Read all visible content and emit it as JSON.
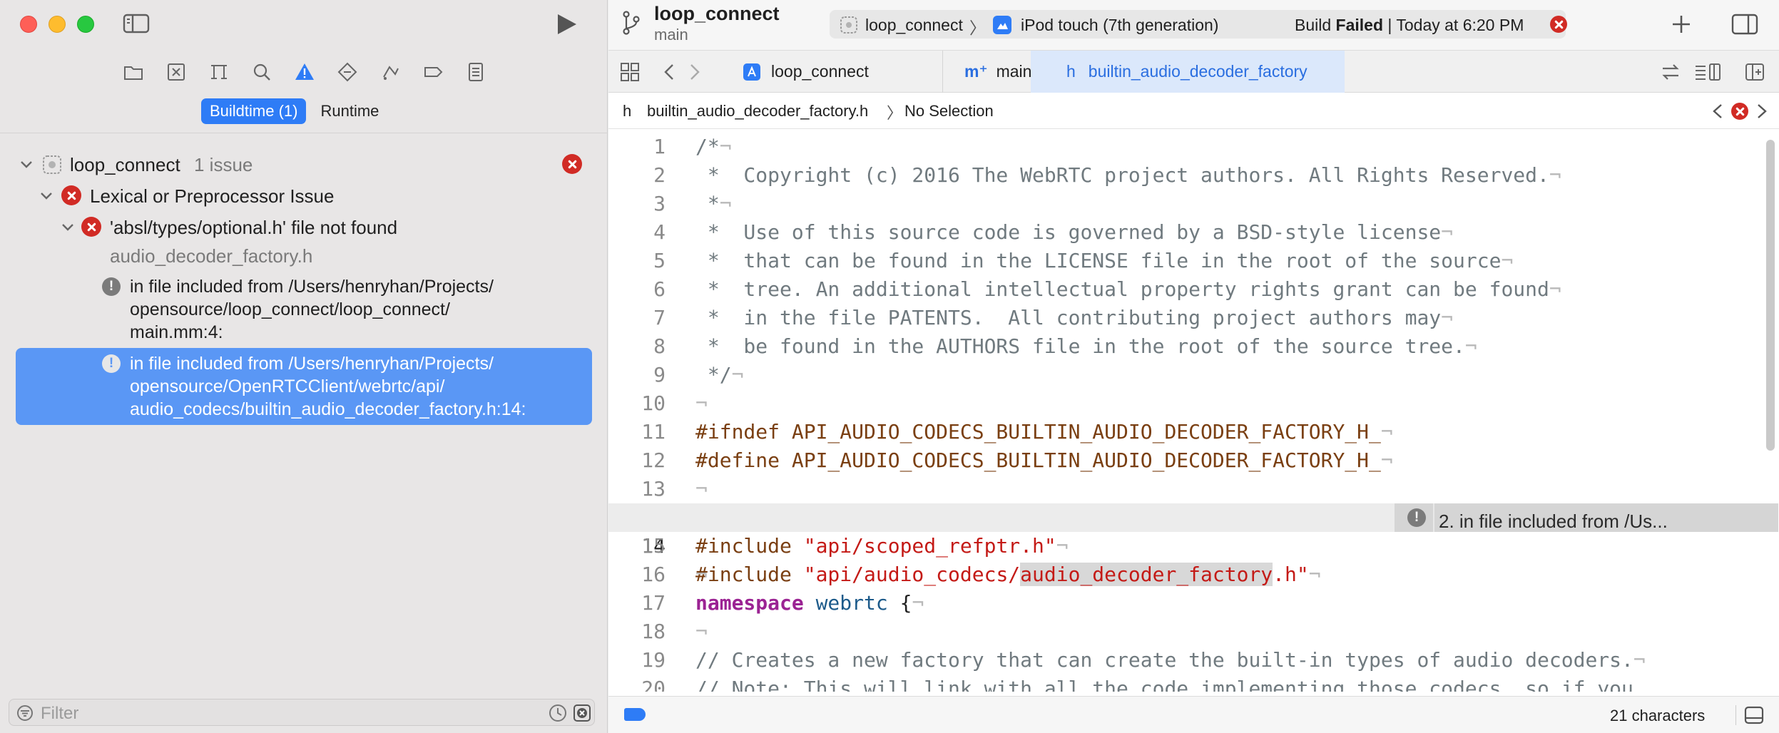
{
  "sidebar": {
    "tabs": {
      "buildtime": "Buildtime (1)",
      "runtime": "Runtime"
    },
    "tree": {
      "project_name": "loop_connect",
      "project_issue_count": "1 issue",
      "category": "Lexical or Preprocessor Issue",
      "error_message": "'absl/types/optional.h' file not found",
      "error_file": "audio_decoder_factory.h",
      "note1_lines": [
        "in file included from /Users/henryhan/Projects/",
        "opensource/loop_connect/loop_connect/",
        "main.mm:4:"
      ],
      "note2_lines": [
        "in file included from /Users/henryhan/Projects/",
        "opensource/OpenRTCClient/webrtc/api/",
        "audio_codecs/builtin_audio_decoder_factory.h:14:"
      ]
    },
    "filter_placeholder": "Filter"
  },
  "toolbar": {
    "project_title": "loop_connect",
    "branch": "main",
    "scheme": "loop_connect",
    "destination": "iPod touch (7th generation)",
    "build_prefix": "Build",
    "build_status": "Failed",
    "build_time": "| Today at 6:20 PM"
  },
  "tabs": [
    {
      "label": "loop_connect"
    },
    {
      "label": "main"
    },
    {
      "label": "builtin_audio_decoder_factory"
    }
  ],
  "jumpbar": {
    "file": "builtin_audio_decoder_factory.h",
    "selection": "No Selection"
  },
  "issue_banner": "2. in file included from /Us...",
  "status": {
    "characters": "21 characters"
  },
  "code": {
    "line_numbers": [
      "1",
      "2",
      "3",
      "4",
      "5",
      "6",
      "7",
      "8",
      "9",
      "10",
      "11",
      "12",
      "13",
      "14",
      "15",
      "16",
      "17",
      "18",
      "19",
      "20"
    ],
    "l1": "/*",
    "l2": " *  Copyright (c) 2016 The WebRTC project authors. All Rights Reserved.",
    "l3": " *",
    "l4": " *  Use of this source code is governed by a BSD-style license",
    "l5": " *  that can be found in the LICENSE file in the root of the source",
    "l6": " *  tree. An additional intellectual property rights grant can be found",
    "l7": " *  in the file PATENTS.  All contributing project authors may",
    "l8": " *  be found in the AUTHORS file in the root of the source tree.",
    "l9": " */",
    "l11": "#ifndef API_AUDIO_CODECS_BUILTIN_AUDIO_DECODER_FACTORY_H_",
    "l12": "#define API_AUDIO_CODECS_BUILTIN_AUDIO_DECODER_FACTORY_H_",
    "l14_pre": "#include ",
    "l14_str1": "\"api/audio_codecs/",
    "l14_str2": "audio_decoder_factory",
    "l14_str3": ".h\"",
    "l15_pre": "#include ",
    "l15_str": "\"api/scoped_refptr.h\"",
    "l17_kw": "namespace",
    "l17_ns": " webrtc",
    "l17_rest": " {",
    "l19": "// Creates a new factory that can create the built-in types of audio decoders.",
    "l20": "// Note: This will link with all the code implementing those codecs, so if you",
    "ws_mark": "¬"
  }
}
